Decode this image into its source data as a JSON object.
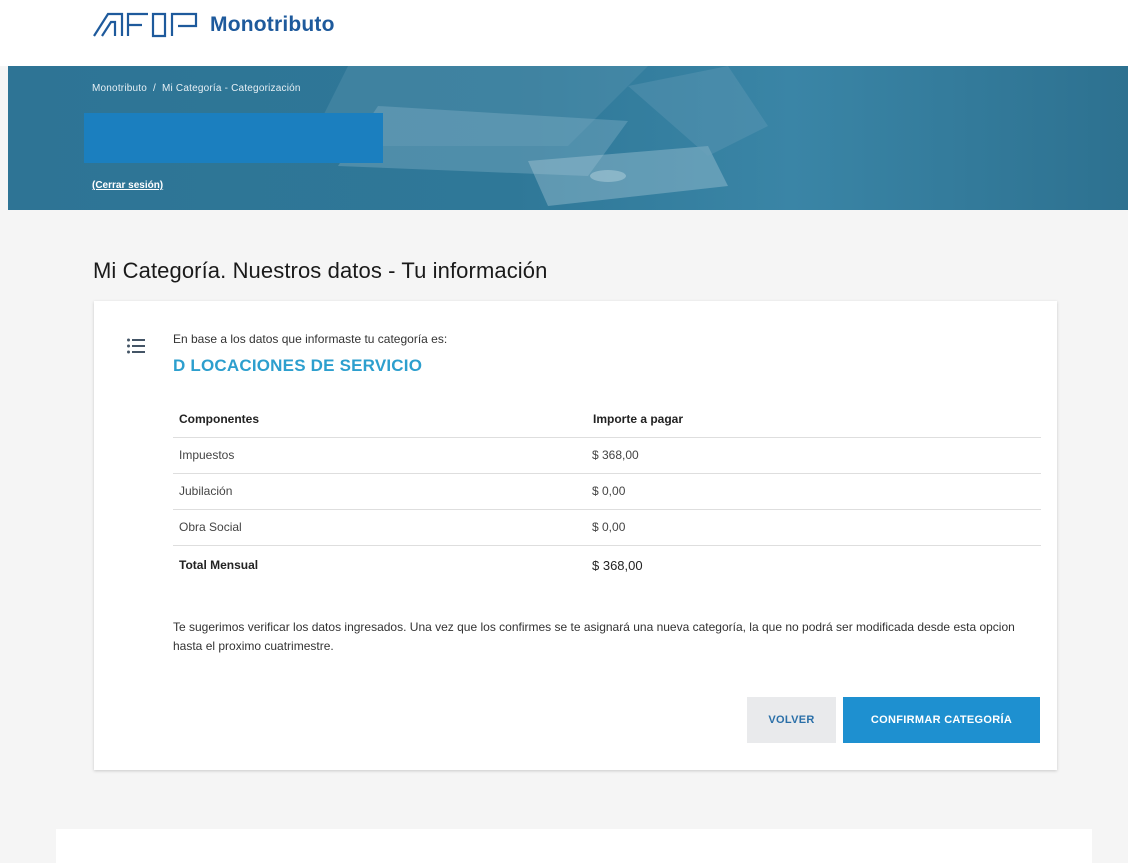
{
  "brand": {
    "name": "Monotributo",
    "logo": "AFIP"
  },
  "breadcrumb": {
    "home": "Monotributo",
    "separator": "/",
    "current": "Mi Categoría - Categorización"
  },
  "session": {
    "logout_label": "(Cerrar sesión)"
  },
  "page": {
    "title": "Mi Categoría. Nuestros datos - Tu información"
  },
  "card": {
    "intro": "En base a los datos que informaste tu categoría es:",
    "category": "D LOCACIONES DE SERVICIO",
    "icon": "list-icon",
    "table": {
      "headers": [
        "Componentes",
        "Importe a pagar"
      ],
      "rows": [
        [
          "Impuestos",
          "$ 368,00"
        ],
        [
          "Jubilación",
          "$ 0,00"
        ],
        [
          "Obra Social",
          "$ 0,00"
        ]
      ],
      "total": [
        "Total Mensual",
        "$ 368,00"
      ]
    },
    "note": "Te sugerimos verificar los datos ingresados. Una vez que los confirmes se te asignará una nueva categoría, la que no podrá ser modificada desde esta opcion hasta el proximo cuatrimestre.",
    "buttons": {
      "back": "VOLVER",
      "confirm": "CONFIRMAR CATEGORÍA"
    }
  },
  "colors": {
    "brand": "#1e5a9c",
    "hero": "#2f7898",
    "accent": "#1e90d0",
    "category": "#2d9fce"
  }
}
